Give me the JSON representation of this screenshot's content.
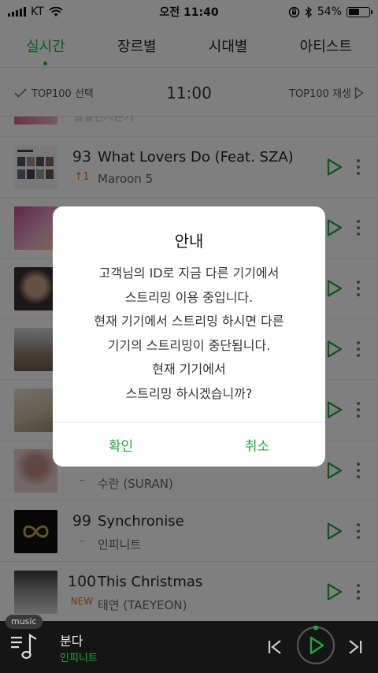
{
  "status_bar": {
    "carrier": "KT",
    "time": "오전 11:40",
    "battery": "54%",
    "battery_level": 0.54
  },
  "tabs": [
    {
      "label": "실시간",
      "active": true
    },
    {
      "label": "장르별",
      "active": false
    },
    {
      "label": "시대별",
      "active": false
    },
    {
      "label": "아티스트",
      "active": false
    }
  ],
  "toolbar": {
    "select_label": "TOP100 선택",
    "time": "11:00",
    "play_label": "TOP100 재생"
  },
  "list": {
    "partial_text": "딜릴런시본가",
    "rows": [
      {
        "rank": "93",
        "change": "↑1",
        "change_type": "up",
        "title": "What Lovers Do (Feat. SZA)",
        "artist": "Maroon 5",
        "thumb": "maroon"
      },
      {
        "rank": "",
        "change": "",
        "change_type": "same",
        "title": "",
        "artist": "",
        "thumb": "pink"
      },
      {
        "rank": "",
        "change": "",
        "change_type": "same",
        "title": "",
        "artist": "",
        "thumb": "dark"
      },
      {
        "rank": "",
        "change": "",
        "change_type": "same",
        "title": "",
        "artist": "",
        "thumb": "people"
      },
      {
        "rank": "",
        "change": "",
        "change_type": "same",
        "title": "",
        "artist": "",
        "thumb": "room"
      },
      {
        "rank": "",
        "change": "–",
        "change_type": "same",
        "title": "",
        "artist": "수란 (SURAN)",
        "thumb": "suran"
      },
      {
        "rank": "99",
        "change": "–",
        "change_type": "same",
        "title": "Synchronise",
        "artist": "인피니트",
        "thumb": "infinite"
      },
      {
        "rank": "100",
        "change": "NEW",
        "change_type": "new",
        "title": "This Christmas",
        "artist": "태연 (TAEYEON)",
        "thumb": "taeyeon"
      }
    ]
  },
  "dialog": {
    "title": "안내",
    "body": [
      "고객님의 ID로 지금 다른 기기에서",
      "스트리밍 이용 중입니다.",
      "현재 기기에서 스트리밍 하시면 다른",
      "기기의 스트리밍이 중단됩니다.",
      "현재 기기에서",
      "스트리밍 하시겠습니까?"
    ],
    "confirm": "확인",
    "cancel": "취소"
  },
  "player": {
    "tag": "music",
    "title": "분다",
    "artist": "인피니트"
  },
  "colors": {
    "accent": "#19b93d",
    "up": "#e66a1d"
  }
}
